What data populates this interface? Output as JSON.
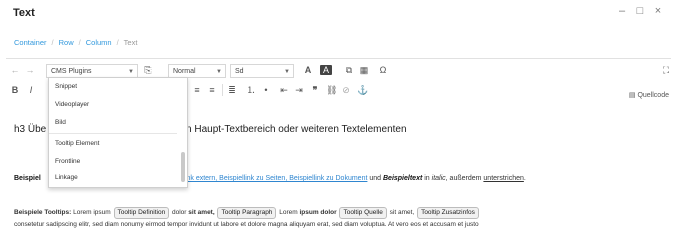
{
  "window": {
    "title": "Text",
    "minimize": "–",
    "maximize": "□",
    "close": "×"
  },
  "breadcrumb": {
    "items": [
      "Container",
      "Row",
      "Column",
      "Text"
    ]
  },
  "toolbar": {
    "undo": "←",
    "redo": "→",
    "plugins_dropdown_value": "CMS Plugins",
    "paste": "⎘",
    "format_value": "Normal",
    "font_value": "Sd",
    "size_value": "",
    "text_color": "A",
    "bg_color": "A",
    "maximize_icon": "⛶",
    "bold": "B",
    "italic": "I",
    "quellcode_label": "Quellcode"
  },
  "plugins_menu": {
    "items": [
      "Snippet",
      "Videoplayer",
      "Bild",
      "Tooltip Element",
      "Frontline",
      "Linkage"
    ]
  },
  "content": {
    "heading_start": "h3 Übe",
    "heading_end": "len Haupt-Textbereich oder weiteren Textelementen",
    "small_line": "",
    "p1_label": "Beispiel",
    "p1_links": "Beispiellink extern, Beispiellink zu Seiten, Beispiellink zu Dokument",
    "p1_mid": " und ",
    "p1_bold_italic": "Beispieltext",
    "p1_after": " in ",
    "p1_italic": "italic",
    "p1_comma": ", außerdem ",
    "p1_ul": "unterstrichen",
    "p1_end": ".",
    "p2_label": "Beispiele Tooltips:",
    "p2_a": " Lorem ipsum ",
    "tooltip_definition": "Tooltip Definition",
    "p2_b": " dolor ",
    "p2_b_bold": "sit amet,",
    "tooltip_paragraph": "Tooltip Paragraph",
    "p2_c": " Lorem ",
    "p2_c_bold": "ipsum dolor",
    "tooltip_quelle": "Tooltip Quelle",
    "p2_d": " sit amet, ",
    "tooltip_zusatzinfos": "Tooltip Zusatzinfos",
    "p2_line2": "consetetur sadipscing elitr, sed diam nonumy eirmod tempor invidunt ut labore et dolore magna aliquyam erat, sed diam voluptua. At vero eos et accusam et justo"
  }
}
